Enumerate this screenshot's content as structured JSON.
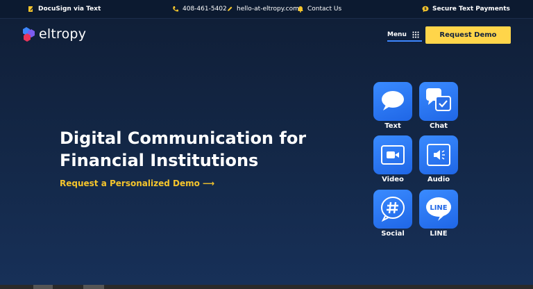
{
  "topbar": {
    "docusign": "DocuSign via Text",
    "phone": "408-461-5402",
    "email": "hello-at-eltropy.com",
    "contact": "Contact Us",
    "payments": "Secure Text Payments"
  },
  "header": {
    "logo_text": "eltropy",
    "menu_label": "Menu",
    "request_demo": "Request Demo"
  },
  "hero": {
    "headline_line1": "Digital Communication for",
    "headline_line2": "Financial Institutions",
    "cta": "Request a Personalized Demo ⟶"
  },
  "channels": [
    {
      "label": "Text",
      "icon": "text-bubble-icon"
    },
    {
      "label": "Chat",
      "icon": "chat-check-icon"
    },
    {
      "label": "Video",
      "icon": "video-icon"
    },
    {
      "label": "Audio",
      "icon": "audio-icon"
    },
    {
      "label": "Social",
      "icon": "hashtag-icon"
    },
    {
      "label": "LINE",
      "icon": "line-icon"
    }
  ],
  "line_icon_text": "LINE",
  "colors": {
    "accent_yellow": "#ffd54a",
    "cta_yellow": "#f5c52c",
    "tile_blue": "#2a78f5",
    "background": "#0f1e36"
  }
}
